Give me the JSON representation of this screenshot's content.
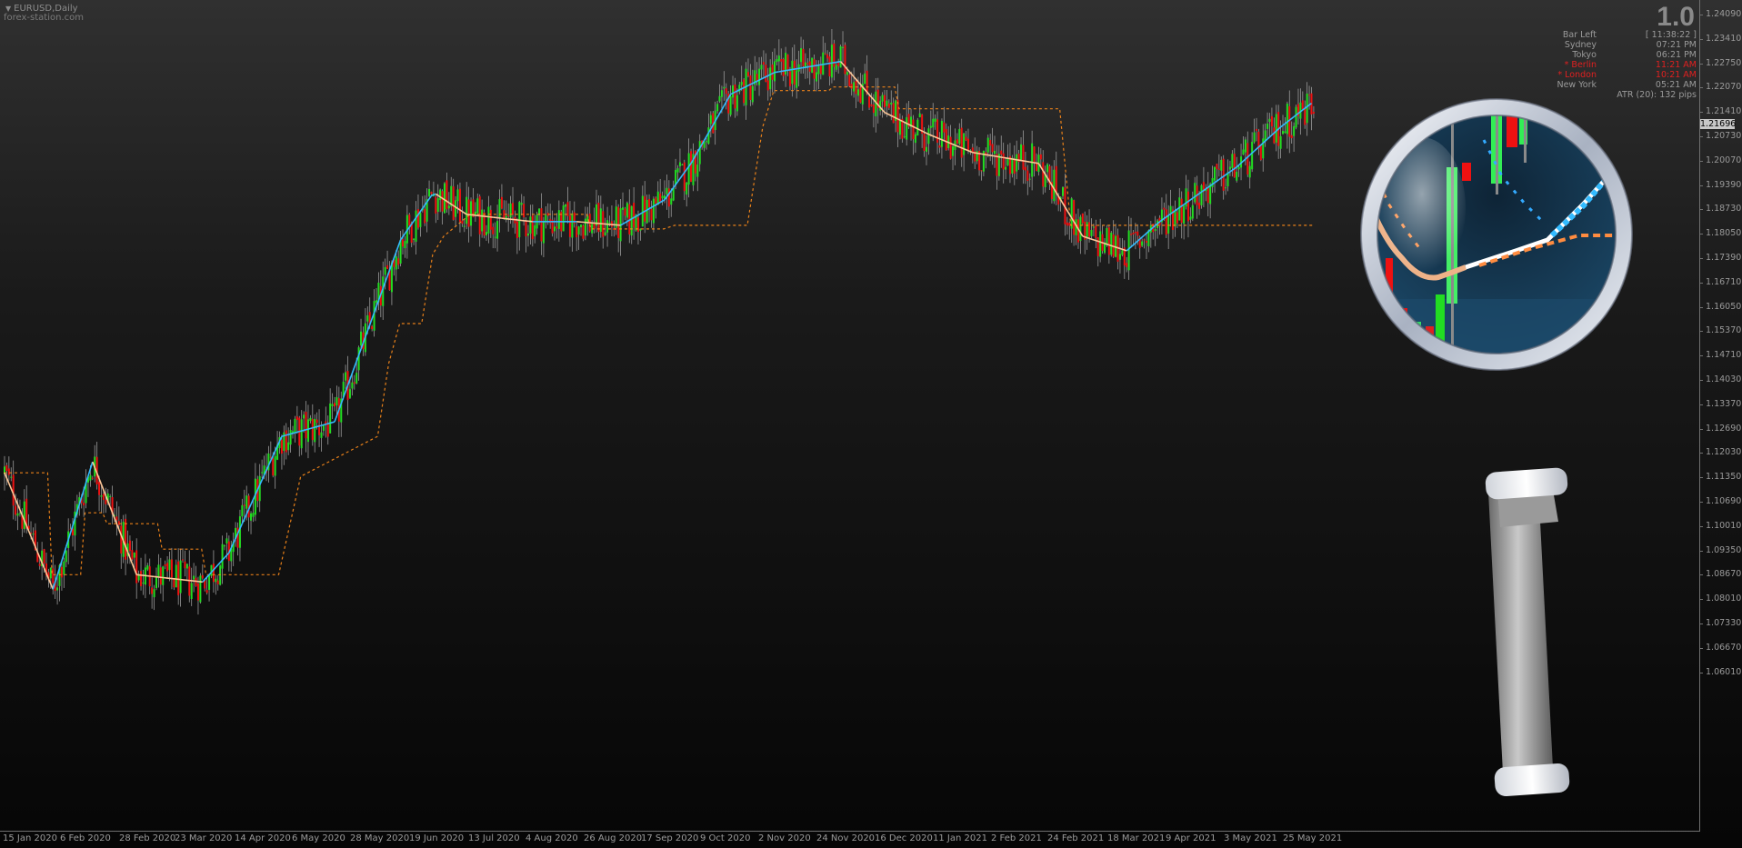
{
  "chart": {
    "symbol": "EURUSD,Daily",
    "watermark": "forex-station.com",
    "big_number": "1.0",
    "current_price": "1.21696"
  },
  "info_panel": [
    {
      "label": "Bar Left",
      "value": "[ 11:38:22 ]",
      "alert": false
    },
    {
      "label": "Sydney",
      "value": "07:21 PM",
      "alert": false
    },
    {
      "label": "Tokyo",
      "value": "06:21 PM",
      "alert": false
    },
    {
      "label": "* Berlin",
      "value": "11:21 AM",
      "alert": true
    },
    {
      "label": "* London",
      "value": "10:21 AM",
      "alert": true
    },
    {
      "label": "New York",
      "value": "05:21 AM",
      "alert": false
    }
  ],
  "atr": "ATR (20): 132 pips",
  "price_axis": [
    "1.24090",
    "1.23410",
    "1.22750",
    "1.22070",
    "1.21410",
    "1.20730",
    "1.20070",
    "1.19390",
    "1.18730",
    "1.18050",
    "1.17390",
    "1.16710",
    "1.16050",
    "1.15370",
    "1.14710",
    "1.14030",
    "1.13370",
    "1.12690",
    "1.12030",
    "1.11350",
    "1.10690",
    "1.10010",
    "1.09350",
    "1.08670",
    "1.08010",
    "1.07330",
    "1.06670",
    "1.06010"
  ],
  "time_axis": [
    "15 Jan 2020",
    "6 Feb 2020",
    "28 Feb 2020",
    "23 Mar 2020",
    "14 Apr 2020",
    "6 May 2020",
    "28 May 2020",
    "19 Jun 2020",
    "13 Jul 2020",
    "4 Aug 2020",
    "26 Aug 2020",
    "17 Sep 2020",
    "9 Oct 2020",
    "2 Nov 2020",
    "24 Nov 2020",
    "16 Dec 2020",
    "11 Jan 2021",
    "2 Feb 2021",
    "24 Feb 2021",
    "18 Mar 2021",
    "9 Apr 2021",
    "3 May 2021",
    "25 May 2021"
  ],
  "colors": {
    "bull": "#22dd22",
    "bear": "#ee1111",
    "wick": "#9a9a9a",
    "ma_up": "#33bbff",
    "ma_down": "#ffc898",
    "band_up": "#1e90ff",
    "band_down": "#ff8c1a"
  },
  "ma_anchors": [
    [
      0,
      1.115
    ],
    [
      22,
      1.083
    ],
    [
      40,
      1.118
    ],
    [
      60,
      1.087
    ],
    [
      90,
      1.085
    ],
    [
      102,
      1.093
    ],
    [
      126,
      1.125
    ],
    [
      150,
      1.129
    ],
    [
      180,
      1.179
    ],
    [
      195,
      1.192
    ],
    [
      210,
      1.186
    ],
    [
      240,
      1.184
    ],
    [
      260,
      1.184
    ],
    [
      280,
      1.183
    ],
    [
      300,
      1.19
    ],
    [
      312,
      1.2
    ],
    [
      330,
      1.219
    ],
    [
      350,
      1.225
    ],
    [
      380,
      1.228
    ],
    [
      400,
      1.214
    ],
    [
      420,
      1.208
    ],
    [
      440,
      1.203
    ],
    [
      470,
      1.2
    ],
    [
      490,
      1.18
    ],
    [
      510,
      1.176
    ],
    [
      525,
      1.184
    ],
    [
      560,
      1.199
    ],
    [
      580,
      1.21
    ],
    [
      595,
      1.217
    ]
  ],
  "band_points": [
    [
      0,
      1.115
    ],
    [
      20,
      1.115
    ],
    [
      22,
      1.087
    ],
    [
      35,
      1.087
    ],
    [
      37,
      1.104
    ],
    [
      45,
      1.104
    ],
    [
      47,
      1.101
    ],
    [
      70,
      1.101
    ],
    [
      72,
      1.094
    ],
    [
      90,
      1.094
    ],
    [
      92,
      1.087
    ],
    [
      125,
      1.087
    ],
    [
      135,
      1.114
    ],
    [
      170,
      1.125
    ],
    [
      175,
      1.145
    ],
    [
      180,
      1.156
    ],
    [
      190,
      1.156
    ],
    [
      195,
      1.175
    ],
    [
      200,
      1.18
    ],
    [
      212,
      1.186
    ],
    [
      240,
      1.186
    ],
    [
      265,
      1.186
    ],
    [
      267,
      1.182
    ],
    [
      300,
      1.182
    ],
    [
      305,
      1.183
    ],
    [
      332,
      1.183
    ],
    [
      338,
      1.183
    ],
    [
      345,
      1.21
    ],
    [
      350,
      1.22
    ],
    [
      375,
      1.22
    ],
    [
      377,
      1.221
    ],
    [
      405,
      1.221
    ],
    [
      407,
      1.215
    ],
    [
      480,
      1.215
    ],
    [
      485,
      1.183
    ],
    [
      520,
      1.183
    ],
    [
      595,
      1.183
    ]
  ]
}
